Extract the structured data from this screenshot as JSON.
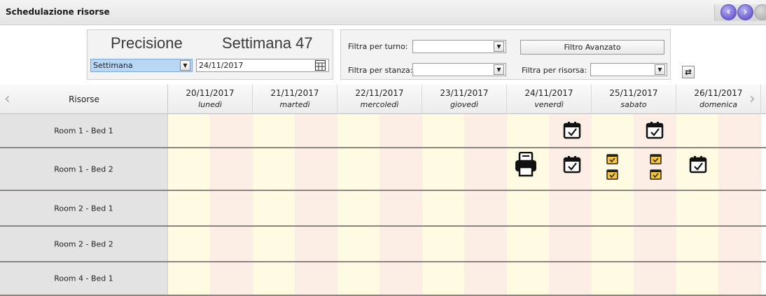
{
  "window": {
    "title": "Schedulazione risorse"
  },
  "nav": {
    "prev_icon": "chevron-left-icon",
    "next_icon": "chevron-right-icon"
  },
  "precision": {
    "label": "Precisione",
    "week_label": "Settimana 47",
    "mode_value": "Settimana",
    "date_value": "24/11/2017"
  },
  "filters": {
    "turno_label": "Filtra per turno:",
    "stanza_label": "Filtra per stanza:",
    "risorsa_label": "Filtra per risorsa:",
    "advanced_button": "Filtro Avanzato",
    "turno_value": "",
    "stanza_value": "",
    "risorsa_value": ""
  },
  "grid": {
    "resources_header": "Risorse",
    "days": [
      {
        "date": "20/11/2017",
        "weekday": "lunedì"
      },
      {
        "date": "21/11/2017",
        "weekday": "martedì"
      },
      {
        "date": "22/11/2017",
        "weekday": "mercoledì"
      },
      {
        "date": "23/11/2017",
        "weekday": "giovedì"
      },
      {
        "date": "24/11/2017",
        "weekday": "venerdì"
      },
      {
        "date": "25/11/2017",
        "weekday": "sabato"
      },
      {
        "date": "26/11/2017",
        "weekday": "domenica"
      }
    ],
    "rows": [
      {
        "label": "Room 1 - Bed 1"
      },
      {
        "label": "Room 1 - Bed 2"
      },
      {
        "label": "Room 2 - Bed 1"
      },
      {
        "label": "Room 2 - Bed 2"
      },
      {
        "label": "Room 4 - Bed 1"
      }
    ]
  },
  "colors": {
    "morning_bg": "#fffbe2",
    "afternoon_bg": "#fdeee5",
    "nav_accent": "#6d60d4",
    "small_event": "#f5c542"
  }
}
